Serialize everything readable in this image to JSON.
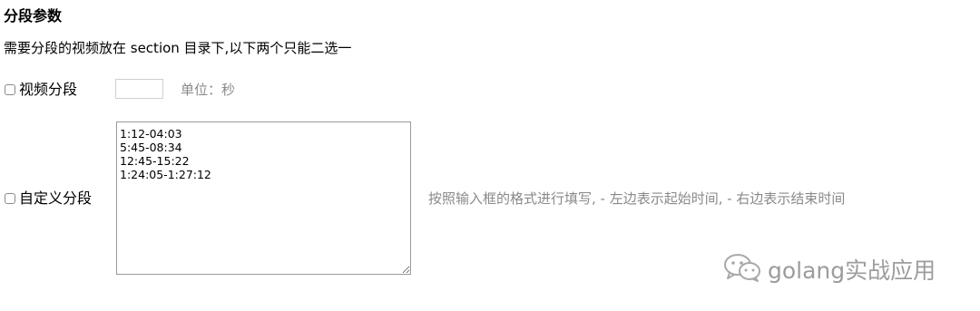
{
  "section": {
    "title": "分段参数",
    "description": "需要分段的视频放在 section 目录下,以下两个只能二选一"
  },
  "video_segment": {
    "label": "视频分段",
    "input_value": "",
    "unit": "单位：秒"
  },
  "custom_segment": {
    "label": "自定义分段",
    "textarea_value": "1:12-04:03\n5:45-08:34\n12:45-15:22\n1:24:05-1:27:12",
    "hint": "按照输入框的格式进行填写, - 左边表示起始时间, - 右边表示结束时间"
  },
  "watermark": {
    "text": "golang实战应用",
    "icon": "wechat-icon"
  }
}
